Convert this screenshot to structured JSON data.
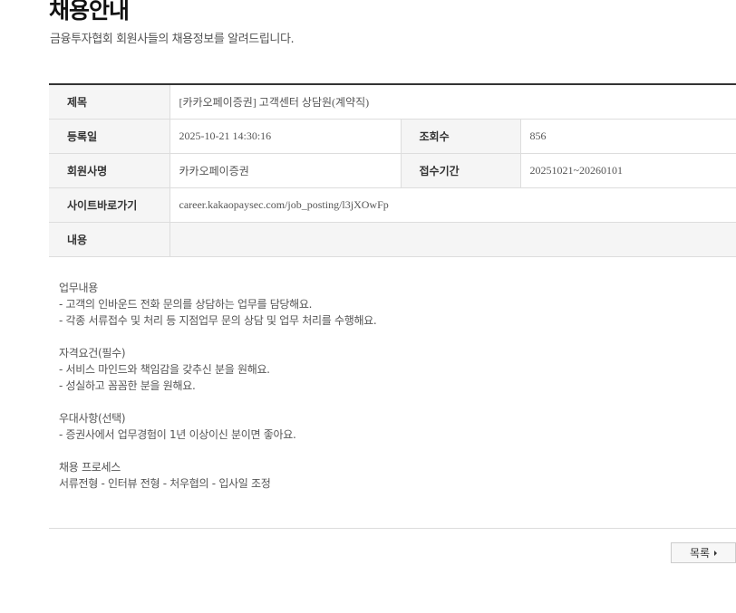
{
  "header": {
    "title": "채용안내",
    "subtitle": "금융투자협회 회원사들의 채용정보를 알려드립니다."
  },
  "detail": {
    "title_label": "제목",
    "title_value": "[카카오페이증권] 고객센터 상담원(계약직)",
    "date_label": "등록일",
    "date_value": "2025-10-21 14:30:16",
    "views_label": "조회수",
    "views_value": "856",
    "company_label": "회원사명",
    "company_value": "카카오페이증권",
    "period_label": "접수기간",
    "period_value": "20251021~20260101",
    "site_label": "사이트바로가기",
    "site_value": "career.kakaopaysec.com/job_posting/l3jXOwFp",
    "content_label": "내용"
  },
  "content": {
    "lines": [
      "업무내용",
      "- 고객의 인바운드 전화 문의를 상담하는 업무를 담당해요.",
      "- 각종 서류접수 및 처리 등 지점업무 문의 상담 및 업무 처리를 수행해요.",
      "",
      "자격요건(필수)",
      "- 서비스 마인드와 책임감을 갖추신 분을 원해요.",
      "- 성실하고 꼼꼼한 분을 원해요.",
      "",
      "우대사항(선택)",
      "- 증권사에서 업무경험이 1년 이상이신 분이면 좋아요.",
      "",
      "채용 프로세스",
      "서류전형 - 인터뷰 전형 - 처우협의 - 입사일 조정"
    ]
  },
  "footer": {
    "list_button_label": "목록",
    "list_button_icon": "arrow-right-icon"
  }
}
